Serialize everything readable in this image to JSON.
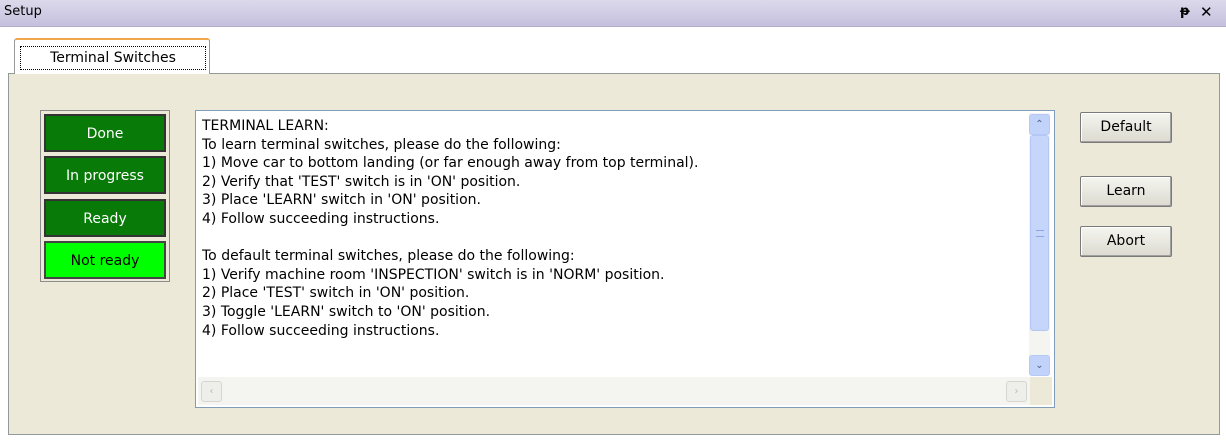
{
  "window": {
    "title": "Setup",
    "pin_glyph": "ᵽ",
    "close_glyph": "✕"
  },
  "tabs": [
    {
      "label": "Terminal Switches",
      "active": true
    }
  ],
  "status_indicators": [
    {
      "label": "Done",
      "color": "#077a07"
    },
    {
      "label": "In progress",
      "color": "#077a07"
    },
    {
      "label": "Ready",
      "color": "#077a07"
    },
    {
      "label": "Not ready",
      "color": "#00ff00"
    }
  ],
  "instructions": {
    "text": "TERMINAL LEARN:\nTo learn terminal switches, please do the following:\n1) Move car to bottom landing (or far enough away from top terminal).\n2) Verify that 'TEST' switch is in 'ON' position.\n3) Place 'LEARN' switch in 'ON' position.\n4) Follow succeeding instructions.\n\nTo default terminal switches, please do the following:\n1) Verify machine room 'INSPECTION' switch is in 'NORM' position.\n2) Place 'TEST' switch in 'ON' position.\n3) Toggle 'LEARN' switch to 'ON' position.\n4) Follow succeeding instructions."
  },
  "buttons": {
    "default_label": "Default",
    "learn_label": "Learn",
    "abort_label": "Abort"
  },
  "scroll_glyphs": {
    "up": "⌃",
    "down": "⌄",
    "left": "‹",
    "right": "›"
  }
}
